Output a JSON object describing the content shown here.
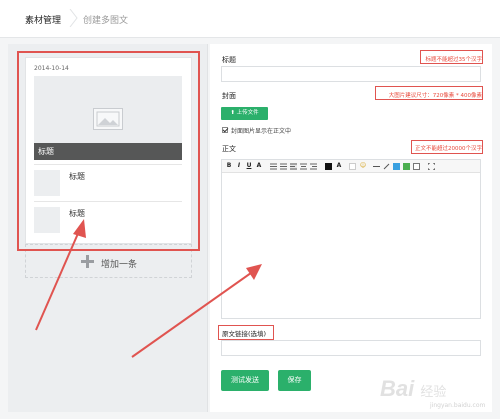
{
  "breadcrumb": {
    "parent": "素材管理",
    "current": "创建多图文"
  },
  "preview": {
    "date": "2014-10-14",
    "cover_title": "标题",
    "items": [
      {
        "title": "标题"
      },
      {
        "title": "标题"
      }
    ],
    "add_label": "增加一条"
  },
  "form": {
    "title_label": "标题",
    "title_hint": "标题不能超过35个汉字",
    "cover_label": "封面",
    "cover_hint": "大图片建议尺寸：720像素 * 400像素",
    "upload_label": "上传文件",
    "show_cover_label": "封面图片显示在正文中",
    "show_cover_checked": true,
    "body_label": "正文",
    "body_hint": "正文不能超过20000个汉字",
    "source_label": "原文链接(选填)",
    "preview_button": "测试发送",
    "save_button": "保存"
  },
  "colors": {
    "accent": "#2bb06b",
    "annotation": "#e05450",
    "hint": "#e84a3c"
  },
  "watermark": {
    "text": "Bai",
    "paw": "经验",
    "sub": "jingyan.baidu.com"
  }
}
